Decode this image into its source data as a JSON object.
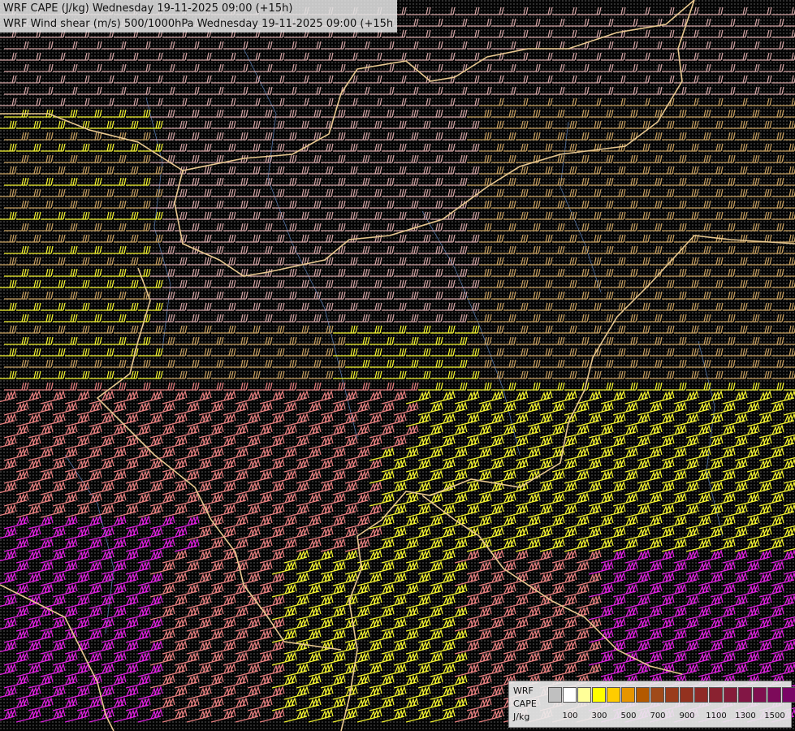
{
  "header": {
    "line1": "WRF CAPE (J/kg) Wednesday 19-11-2025 09:00 (+15h)",
    "line2": "WRF Wind shear (m/s) 500/1000hPa Wednesday 19-11-2025 09:00 (+15h)"
  },
  "legend": {
    "label_line1": "WRF",
    "label_line2": "CAPE",
    "label_line3": "J/kg",
    "swatches": [
      "#c0c0c0",
      "#ffffff",
      "#ffff99",
      "#ffff00",
      "#ffcc00",
      "#e69500",
      "#b35900",
      "#a04a1a",
      "#9a3c1c",
      "#93321f",
      "#8f2a27",
      "#8a2230",
      "#861c3a",
      "#821645",
      "#801050",
      "#7d0a5a",
      "#7a0566",
      "#78016e"
    ],
    "tick_labels": [
      "100",
      "300",
      "500",
      "700",
      "900",
      "1100",
      "1300",
      "1500"
    ]
  },
  "colors": {
    "barb_light": "#d4a5a5",
    "barb_tan": "#c8a060",
    "barb_yellow": "#f5f530",
    "barb_salmon": "#e98080",
    "barb_magenta": "#e020e0",
    "borders": "#e8c890",
    "rivers": "#5577aa"
  }
}
